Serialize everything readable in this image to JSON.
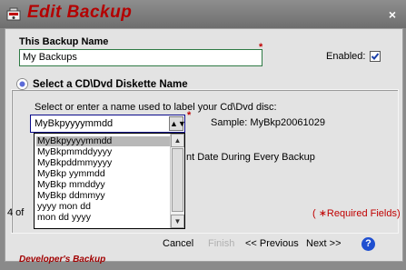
{
  "window": {
    "title": "Edit  Backup",
    "close_glyph": "×"
  },
  "backup_name": {
    "label": "This Backup Name",
    "required_mark": "*",
    "value": "My Backups",
    "enabled_label": "Enabled:",
    "enabled_checked": true
  },
  "group": {
    "title": "Select a CD\\Dvd Diskette Name",
    "instruction": "Select or enter a name used to label your Cd\\Dvd disc:",
    "required_mark": "*",
    "sample_label": "Sample:  MyBkp20061029",
    "behind_text": "nt Date During Every Backup"
  },
  "combo": {
    "value": "MyBkpyyyymmdd",
    "options": [
      "MyBkpyyyymmdd",
      "MyBkpmmddyyyy",
      "MyBkpddmmyyyy",
      "MyBkp yymmdd",
      "MyBkp mmddyy",
      "MyBkp ddmmyy",
      "yyyy mon dd",
      "mon dd yyyy"
    ],
    "selected_index": 0
  },
  "status": {
    "step_text": "4 of",
    "required_fields": "( ∗Required Fields)"
  },
  "buttons": {
    "cancel": "Cancel",
    "finish": "Finish",
    "previous": "<< Previous",
    "next": "Next >>",
    "help": "?"
  },
  "footer": {
    "brand": "Developer's Backup"
  },
  "colors": {
    "title_red": "#b40000",
    "accent_green": "#2e7a44",
    "help_blue": "#1f4fd0"
  }
}
